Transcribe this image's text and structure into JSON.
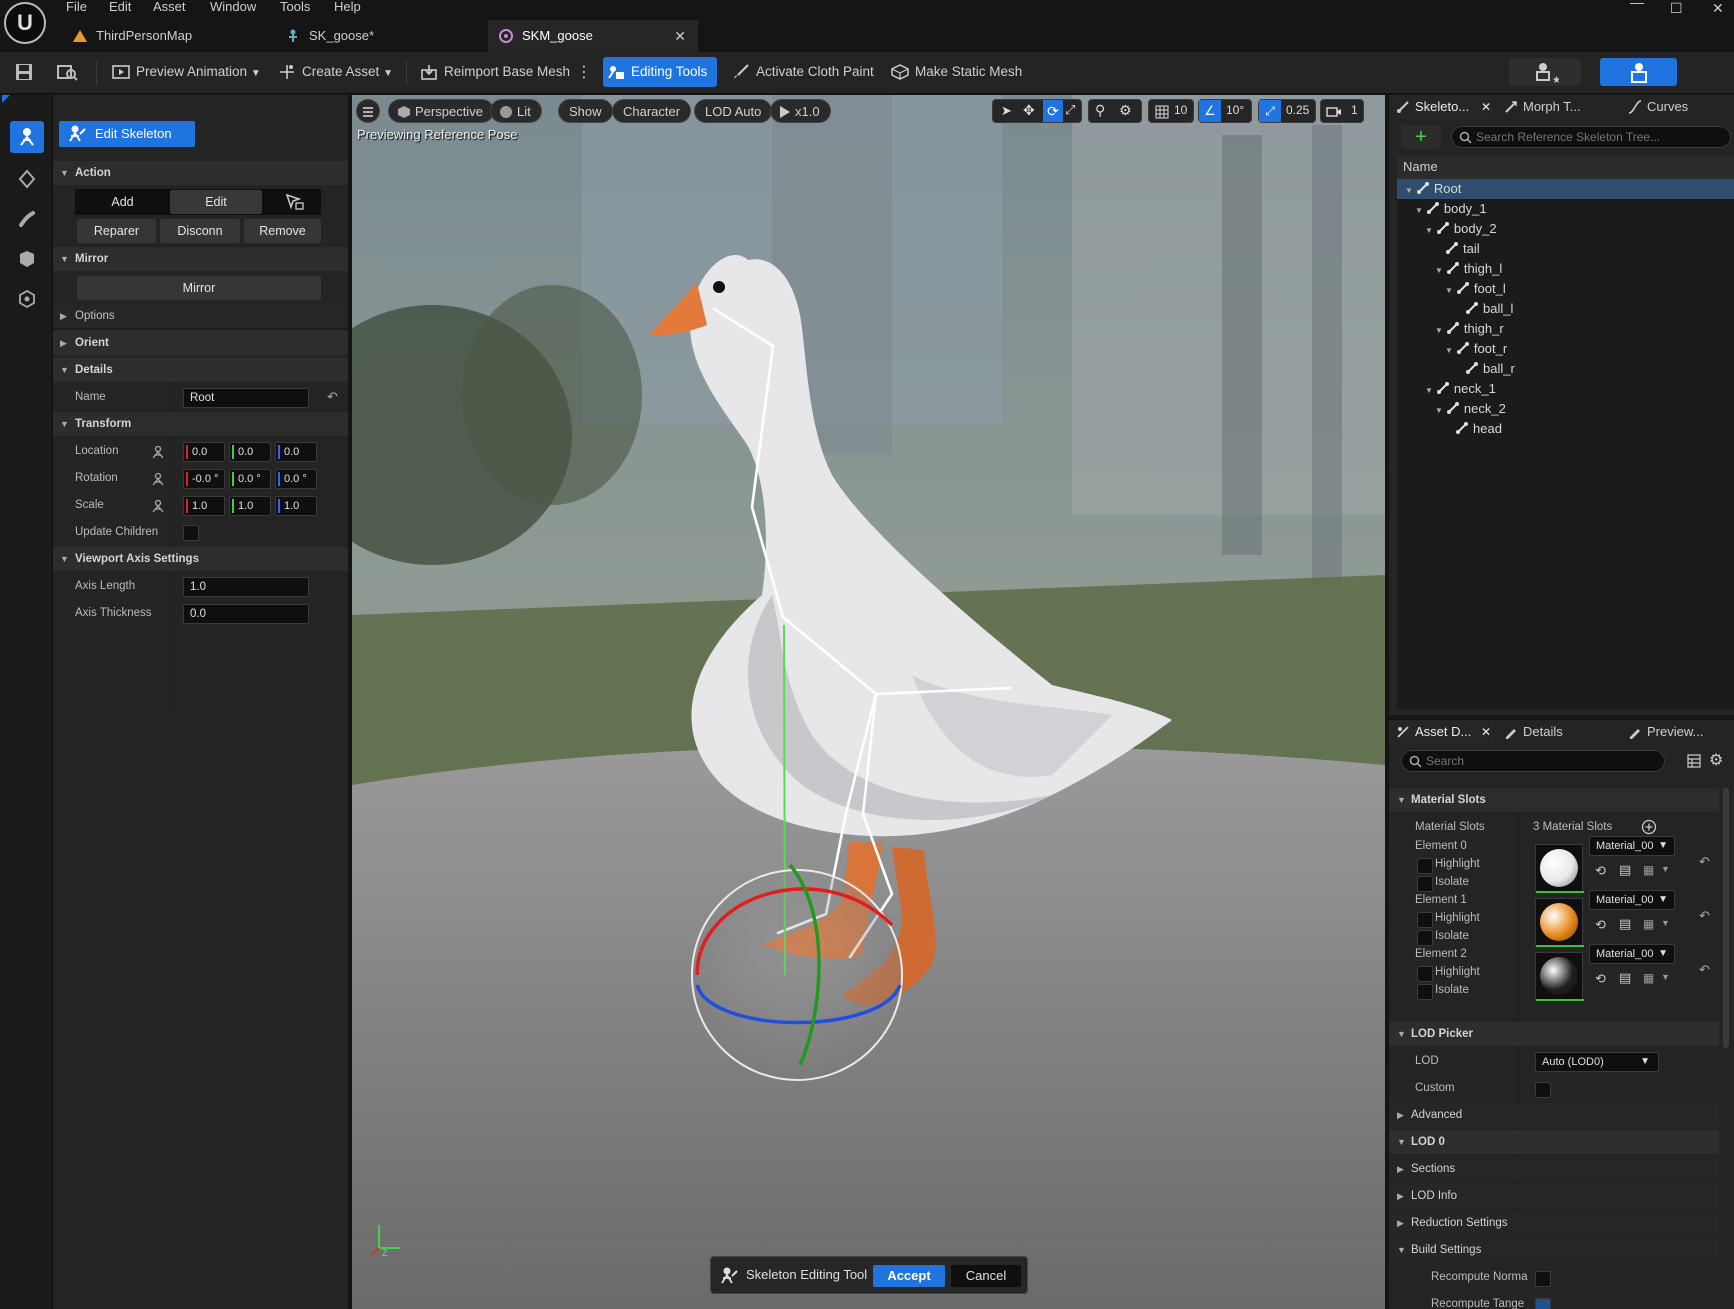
{
  "menu": {
    "items": [
      "File",
      "Edit",
      "Asset",
      "Window",
      "Tools",
      "Help"
    ],
    "logo": "U"
  },
  "tabs": [
    {
      "label": "ThirdPersonMap",
      "icon": "level-icon"
    },
    {
      "label": "SK_goose*",
      "icon": "skeleton-icon"
    },
    {
      "label": "SKM_goose",
      "icon": "skeletal-mesh-icon",
      "close": "✕"
    }
  ],
  "window_controls": {
    "minimize": "—",
    "maximize": "☐",
    "close": "✕"
  },
  "toolbar": {
    "preview_animation": "Preview Animation",
    "create_asset": "Create Asset",
    "reimport_base_mesh": "Reimport Base Mesh",
    "editing_tools": "Editing Tools",
    "activate_cloth_paint": "Activate Cloth Paint",
    "make_static_mesh": "Make Static Mesh"
  },
  "left_panel": {
    "mode_button": "Edit Skeleton",
    "sections": {
      "action": "Action",
      "mirror": "Mirror",
      "options": "Options",
      "orient": "Orient",
      "details": "Details",
      "transform": "Transform",
      "viewport_axis": "Viewport Axis Settings"
    },
    "action_buttons": {
      "add": "Add",
      "edit": "Edit",
      "reparent": "Reparer",
      "disconnect": "Disconn",
      "remove": "Remove"
    },
    "mirror_button": "Mirror",
    "name_label": "Name",
    "name_value": "Root",
    "location_label": "Location",
    "location": [
      "0.0",
      "0.0",
      "0.0"
    ],
    "rotation_label": "Rotation",
    "rotation": [
      "-0.0 °",
      "0.0 °",
      "0.0 °"
    ],
    "scale_label": "Scale",
    "scale": [
      "1.0",
      "1.0",
      "1.0"
    ],
    "update_children": "Update Children",
    "axis_length_label": "Axis Length",
    "axis_length": "1.0",
    "axis_thickness_label": "Axis Thickness",
    "axis_thickness": "0.0"
  },
  "viewport": {
    "perspective": "Perspective",
    "lit": "Lit",
    "show": "Show",
    "character": "Character",
    "lod": "LOD Auto",
    "speed": "x1.0",
    "grid": "10",
    "angle": "10°",
    "scale": "0.25",
    "camera": "1",
    "status": "Previewing Reference Pose",
    "axis_z": "Z"
  },
  "skeleton_tree": {
    "tabs": [
      "Skeleto...",
      "Morph T...",
      "Curves"
    ],
    "tab_close": "✕",
    "search_placeholder": "Search Reference Skeleton Tree...",
    "column": "Name",
    "bones": [
      {
        "name": "Root",
        "depth": 0
      },
      {
        "name": "body_1",
        "depth": 1
      },
      {
        "name": "body_2",
        "depth": 2
      },
      {
        "name": "tail",
        "depth": 3
      },
      {
        "name": "thigh_l",
        "depth": 3
      },
      {
        "name": "foot_l",
        "depth": 4
      },
      {
        "name": "ball_l",
        "depth": 5
      },
      {
        "name": "thigh_r",
        "depth": 3
      },
      {
        "name": "foot_r",
        "depth": 4
      },
      {
        "name": "ball_r",
        "depth": 5
      },
      {
        "name": "neck_1",
        "depth": 2
      },
      {
        "name": "neck_2",
        "depth": 3
      },
      {
        "name": "head",
        "depth": 4
      }
    ]
  },
  "asset_details": {
    "tabs": [
      "Asset D...",
      "Details",
      "Preview..."
    ],
    "tab_close": "✕",
    "search_placeholder": "Search",
    "material_slots_section": "Material Slots",
    "material_slots_label": "Material Slots",
    "material_slots_count": "3 Material Slots",
    "elements": [
      {
        "label": "Element 0",
        "material": "Material_00",
        "color": "#e8e8e8"
      },
      {
        "label": "Element 1",
        "material": "Material_00",
        "color": "#e88a1c"
      },
      {
        "label": "Element 2",
        "material": "Material_00",
        "color": "#202020"
      }
    ],
    "highlight": "Highlight",
    "isolate": "Isolate",
    "lod_picker_section": "LOD Picker",
    "lod_label": "LOD",
    "lod_value": "Auto (LOD0)",
    "custom_label": "Custom",
    "advanced": "Advanced",
    "lod0": "LOD 0",
    "sections": "Sections",
    "lod_info": "LOD Info",
    "reduction": "Reduction Settings",
    "build": "Build Settings",
    "recompute_normals": "Recompute Norma",
    "recompute_tangents": "Recompute Tange"
  },
  "dock": {
    "title": "Skeleton Editing Tool",
    "accept": "Accept",
    "cancel": "Cancel"
  },
  "colors": {
    "accent": "#1f74e0",
    "selection": "#2f4e6f"
  }
}
